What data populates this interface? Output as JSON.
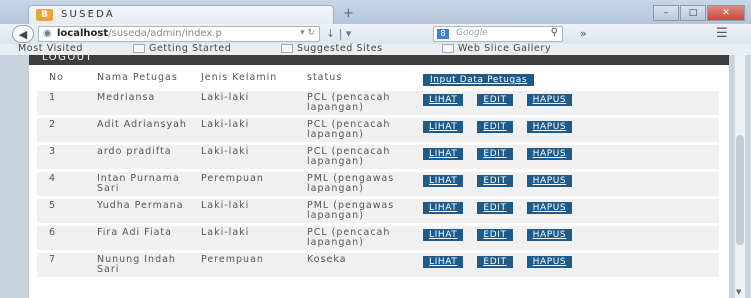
{
  "browser": {
    "tab_title": "SUSEDA",
    "favicon": "B",
    "new_tab": "+",
    "url_host": "localhost",
    "url_path": "/suseda/admin/index.p",
    "search_placeholder": "Google",
    "search_engine_badge": "8",
    "bookmarks": [
      "Most Visited",
      "Getting Started",
      "Suggested Sites",
      "Web Slice Gallery"
    ]
  },
  "page": {
    "logout": "LOGOUT",
    "headers": {
      "no": "No",
      "nama": "Nama Petugas",
      "jk": "Jenis Kelamin",
      "status": "status",
      "input_button": "Input Data Petugas"
    },
    "action_labels": {
      "view": "LIHAT",
      "edit": "EDIT",
      "delete": "HAPUS"
    },
    "rows": [
      {
        "no": "1",
        "nama": "Medriansa",
        "jk": "Laki-laki",
        "status": "PCL (pencacah lapangan)"
      },
      {
        "no": "2",
        "nama": "Adit Adriansyah",
        "jk": "Laki-laki",
        "status": "PCL (pencacah lapangan)"
      },
      {
        "no": "3",
        "nama": "ardo pradifta",
        "jk": "Laki-laki",
        "status": "PCL (pencacah lapangan)"
      },
      {
        "no": "4",
        "nama": "Intan Purnama Sari",
        "jk": "Perempuan",
        "status": "PML (pengawas lapangan)"
      },
      {
        "no": "5",
        "nama": "Yudha Permana",
        "jk": "Laki-laki",
        "status": "PML (pengawas lapangan)"
      },
      {
        "no": "6",
        "nama": "Fira Adi Fiata",
        "jk": "Laki-laki",
        "status": "PCL (pencacah lapangan)"
      },
      {
        "no": "7",
        "nama": "Nunung Indah Sari",
        "jk": "Perempuan",
        "status": "Koseka"
      }
    ]
  },
  "colors": {
    "button_bg": "#1e5a8a",
    "logout_bar": "#3e3e3e",
    "row_bg": "#f0f0f0"
  }
}
